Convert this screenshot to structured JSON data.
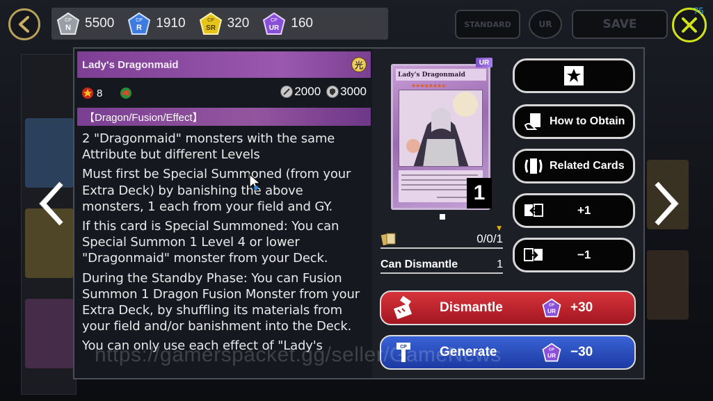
{
  "currency": [
    {
      "code": "N",
      "value": "5500",
      "color": "#9a9ea6",
      "icon": "cp-n-gem-icon"
    },
    {
      "code": "R",
      "value": "1910",
      "color": "#3d7be0",
      "icon": "cp-r-gem-icon"
    },
    {
      "code": "SR",
      "value": "320",
      "color": "#e6c41a",
      "icon": "cp-sr-gem-icon"
    },
    {
      "code": "UR",
      "value": "160",
      "color": "#8a4fd8",
      "icon": "cp-ur-gem-icon"
    }
  ],
  "top_buttons": {
    "standard": "STANDARD",
    "ur": "UR",
    "save": "SAVE"
  },
  "notification_count": "75",
  "card": {
    "name": "Lady's Dragonmaid",
    "attribute_glyph": "光",
    "level": "8",
    "atk": "2000",
    "def": "3000",
    "type_line": "【Dragon/Fusion/Effect】",
    "description": [
      "2 \"Dragonmaid\" monsters with the same Attribute but different Levels",
      "Must first be Special Summoned (from your Extra Deck) by banishing the above monsters, 1 each from your field and GY.",
      "If this card is Special Summoned: You can Special Summon 1 Level 4 or lower \"Dragonmaid\" monster from your Deck.",
      "During the Standby Phase: You can Fusion Summon 1 Dragon Fusion Monster from your Extra Deck, by shuffling its materials from your field and/or banishment into the Deck.",
      "You can only use each effect of \"Lady's"
    ],
    "art_title": "Lady's Dragonmaid",
    "rarity": "UR",
    "copies_in_deck": "1"
  },
  "ownership": {
    "owned": "0/0/1",
    "dismantle_label": "Can Dismantle",
    "dismantle_count": "1"
  },
  "actions": {
    "how_to_obtain": "How to Obtain",
    "related_cards": "Related Cards",
    "add_one": "+1",
    "remove_one": "−1",
    "dismantle": "Dismantle",
    "dismantle_amount": "+30",
    "generate": "Generate",
    "generate_amount": "−30"
  },
  "watermark": "https://gamerspacket.gg/seller/GameNews"
}
